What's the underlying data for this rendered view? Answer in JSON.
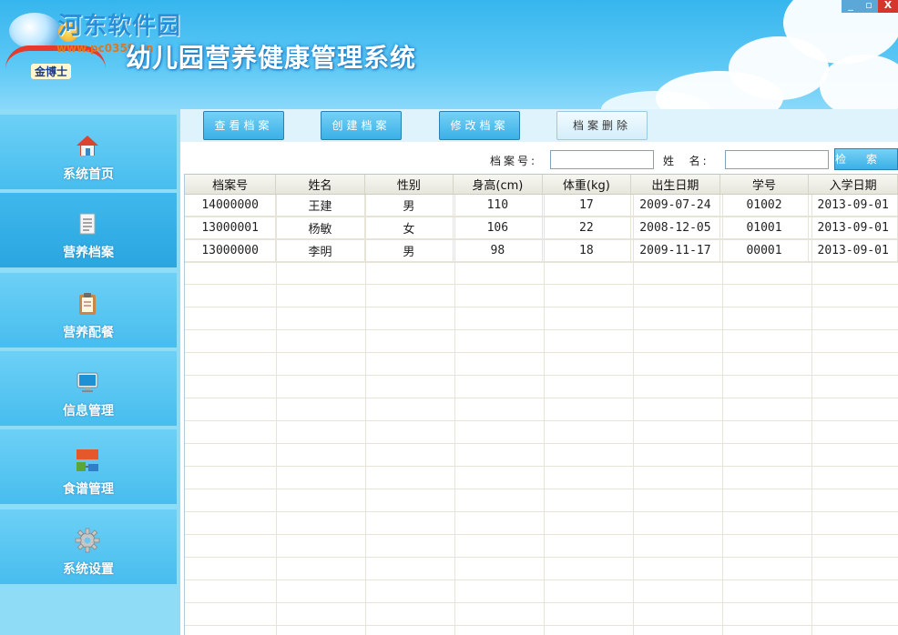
{
  "header": {
    "watermark": "河东软件园",
    "watermark_url": "www.pc0359.cn",
    "logo_text": "金博士",
    "app_title": "幼儿园营养健康管理系统"
  },
  "window_controls": {
    "minimize": "_",
    "restore": "▫",
    "close": "X"
  },
  "sidebar": {
    "items": [
      {
        "label": "系统首页",
        "icon": "home-icon"
      },
      {
        "label": "营养档案",
        "icon": "document-icon"
      },
      {
        "label": "营养配餐",
        "icon": "clipboard-icon"
      },
      {
        "label": "信息管理",
        "icon": "monitor-icon"
      },
      {
        "label": "食谱管理",
        "icon": "network-icon"
      },
      {
        "label": "系统设置",
        "icon": "gear-icon"
      }
    ],
    "active_index": 1
  },
  "toolbar": {
    "view": "查看档案",
    "create": "创建档案",
    "edit": "修改档案",
    "delete": "档案删除"
  },
  "search": {
    "record_no_label": "档案号:",
    "record_no_value": "",
    "name_label": "姓  名:",
    "name_value": "",
    "button": "检索"
  },
  "table": {
    "columns": [
      "档案号",
      "姓名",
      "性别",
      "身高(cm)",
      "体重(kg)",
      "出生日期",
      "学号",
      "入学日期"
    ],
    "rows": [
      [
        "14000000",
        "王建",
        "男",
        "110",
        "17",
        "2009-07-24",
        "01002",
        "2013-09-01"
      ],
      [
        "13000001",
        "杨敏",
        "女",
        "106",
        "22",
        "2008-12-05",
        "01001",
        "2013-09-01"
      ],
      [
        "13000000",
        "李明",
        "男",
        "98",
        "18",
        "2009-11-17",
        "00001",
        "2013-09-01"
      ]
    ]
  }
}
